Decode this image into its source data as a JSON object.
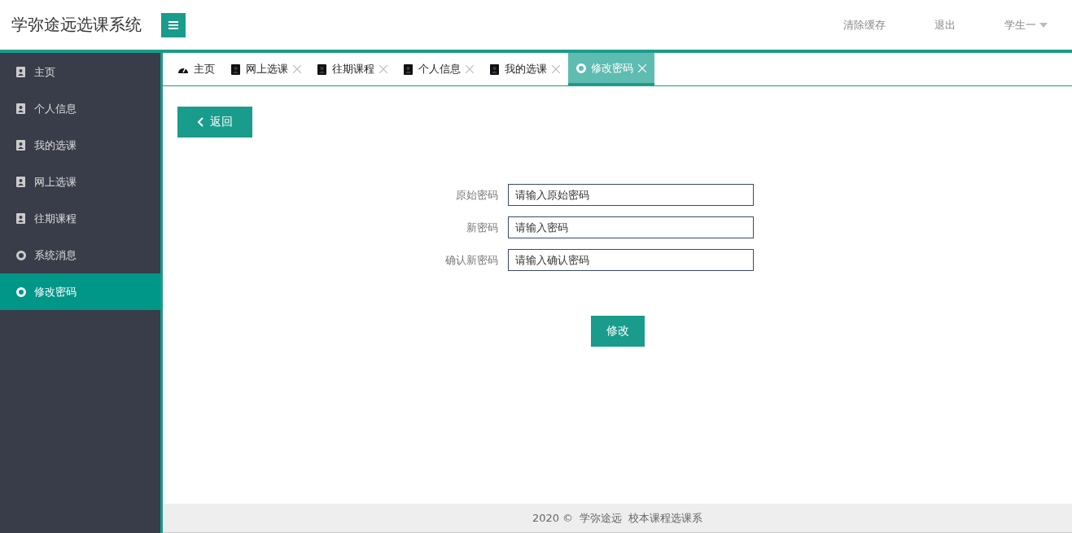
{
  "header": {
    "title": "学弥途远选课系统",
    "links": [
      "清除缓存",
      "退出"
    ],
    "user": "学生一"
  },
  "sidebar": {
    "items": [
      {
        "label": "主页",
        "kind": "card",
        "selected": false
      },
      {
        "label": "个人信息",
        "kind": "card",
        "selected": false
      },
      {
        "label": "我的选课",
        "kind": "card",
        "selected": false
      },
      {
        "label": "网上选课",
        "kind": "card",
        "selected": false
      },
      {
        "label": "往期课程",
        "kind": "card",
        "selected": false
      },
      {
        "label": "系统消息",
        "kind": "ring",
        "selected": false
      },
      {
        "label": "修改密码",
        "kind": "ring",
        "selected": true
      }
    ]
  },
  "tabs": [
    {
      "label": "主页",
      "kind": "gauge",
      "closable": false,
      "selected": false
    },
    {
      "label": "网上选课",
      "kind": "card",
      "closable": true,
      "selected": false
    },
    {
      "label": "往期课程",
      "kind": "card",
      "closable": true,
      "selected": false
    },
    {
      "label": "个人信息",
      "kind": "card",
      "closable": true,
      "selected": false
    },
    {
      "label": "我的选课",
      "kind": "card",
      "closable": true,
      "selected": false
    },
    {
      "label": "修改密码",
      "kind": "ring",
      "closable": true,
      "selected": true
    }
  ],
  "back_button": "返回",
  "form": {
    "fields": [
      {
        "label": "原始密码",
        "placeholder": "请输入原始密码"
      },
      {
        "label": "新密码",
        "placeholder": "请输入密码"
      },
      {
        "label": "确认新密码",
        "placeholder": "请输入确认密码"
      }
    ],
    "submit": "修改"
  },
  "footer": [
    "2020 ©",
    "学弥途远",
    "校本课程选课系"
  ]
}
